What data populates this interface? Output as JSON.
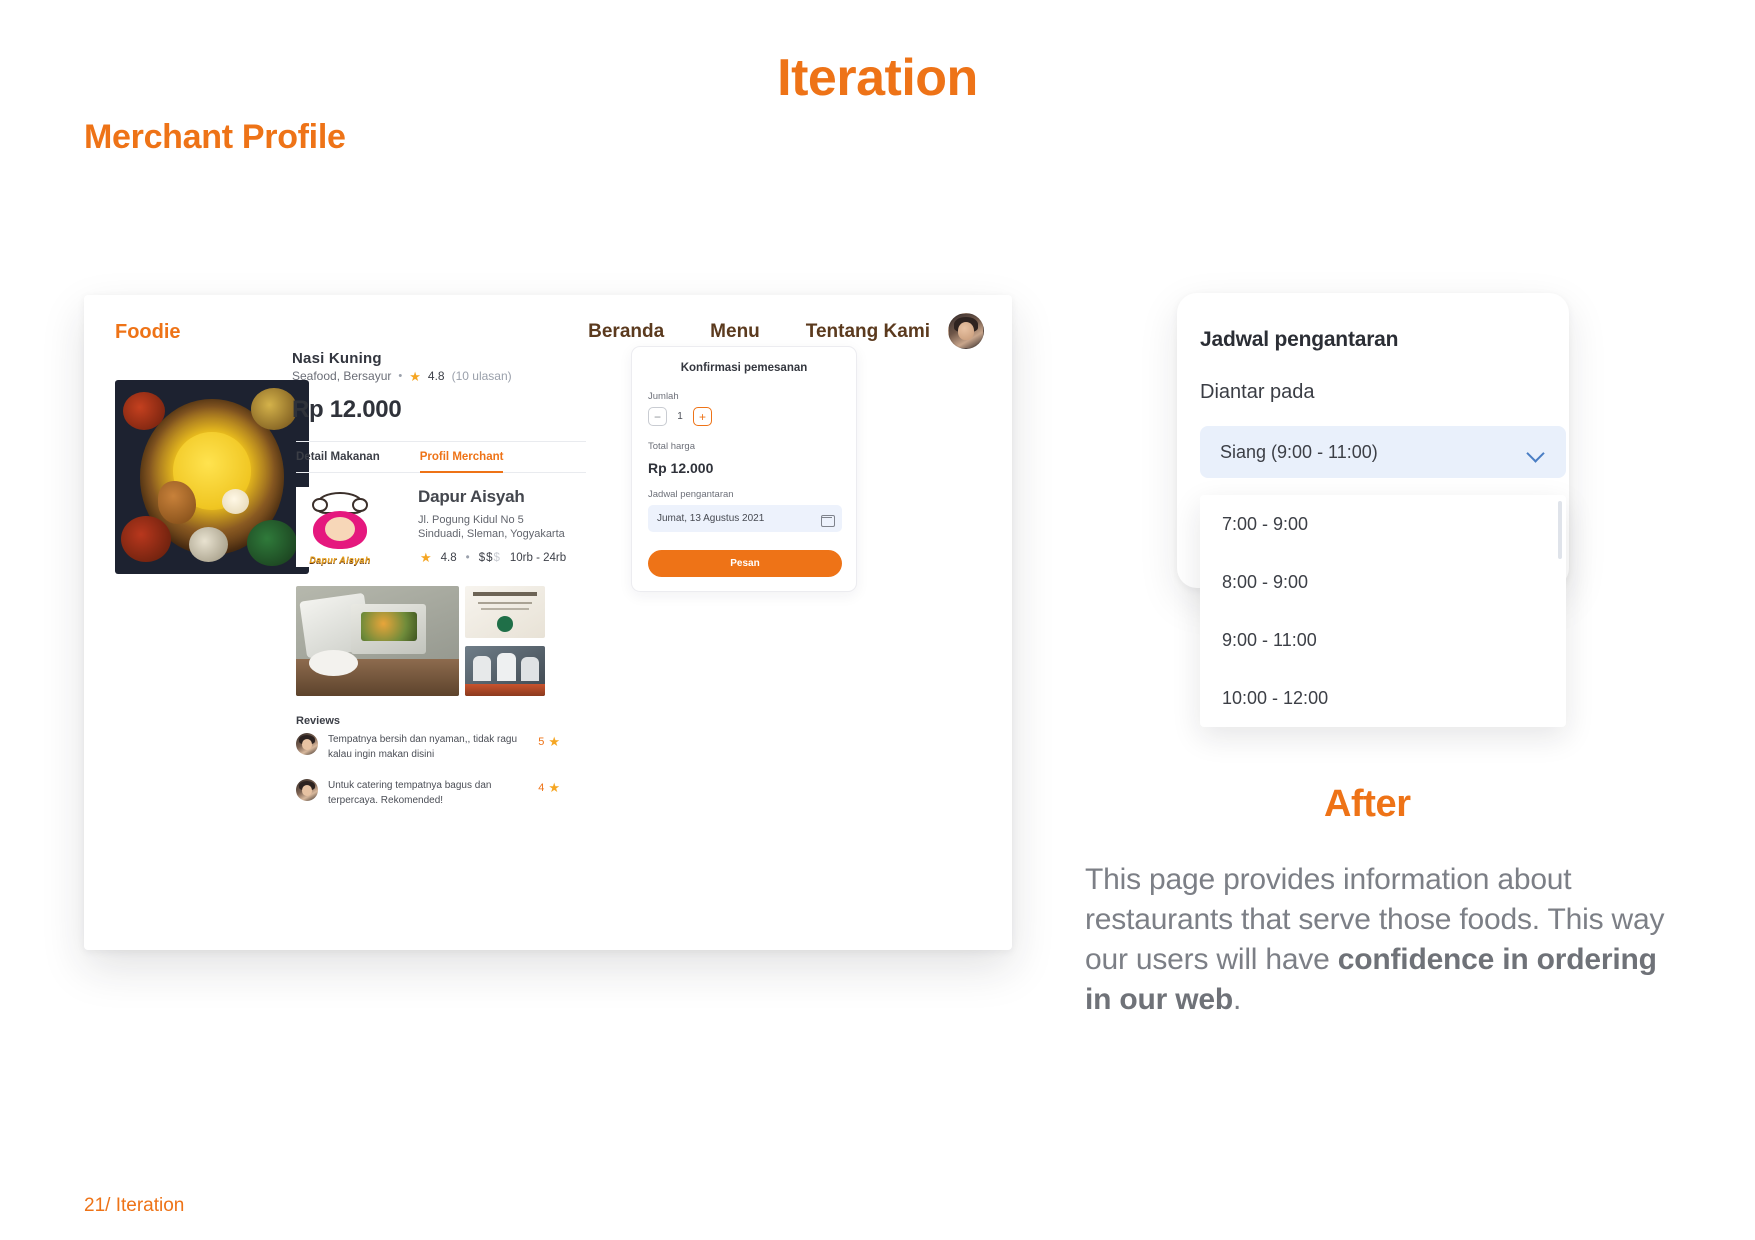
{
  "slide": {
    "title": "Iteration",
    "section_title": "Merchant Profile",
    "footer": "21/ Iteration"
  },
  "mockup": {
    "nav": {
      "brand": "Foodie",
      "links": [
        "Beranda",
        "Menu",
        "Tentang Kami"
      ],
      "avatar_name": "user-avatar"
    },
    "product": {
      "name": "Nasi Kuning",
      "categories": "Seafood, Bersayur",
      "separator": "•",
      "rating": "4.8",
      "reviews_count": "(10 ulasan)",
      "price": "Rp 12.000"
    },
    "tabs": [
      {
        "label": "Detail Makanan",
        "active": false
      },
      {
        "label": "Profil Merchant",
        "active": true
      }
    ],
    "merchant": {
      "logo_label": "Dapur Aisyah",
      "name": "Dapur Aisyah",
      "address_line1": "Jl. Pogung Kidul No 5",
      "address_line2": "Sinduadi, Sleman, Yogyakarta",
      "rating": "4.8",
      "separator": "•",
      "price_level_active": "$$",
      "price_level_inactive": "$",
      "price_range": "10rb - 24rb"
    },
    "gallery": [
      "catering-buffet-photo",
      "halal-certificate-photo",
      "chefs-kitchen-photo"
    ],
    "reviews": {
      "heading": "Reviews",
      "items": [
        {
          "text": "Tempatnya bersih dan nyaman,, tidak ragu kalau ingin makan disini",
          "score": "5"
        },
        {
          "text": "Untuk catering tempatnya bagus dan terpercaya. Rekomended!",
          "score": "4"
        }
      ]
    },
    "order": {
      "title": "Konfirmasi pemesanan",
      "quantity_label": "Jumlah",
      "quantity_value": "1",
      "minus_label": "−",
      "plus_label": "+",
      "total_label": "Total harga",
      "total_value": "Rp 12.000",
      "schedule_label": "Jadwal pengantaran",
      "schedule_value": "Jumat, 13 Agustus 2021",
      "submit_label": "Pesan"
    }
  },
  "schedule_panel": {
    "heading": "Jadwal pengantaran",
    "subheading": "Diantar pada",
    "selected_value": "Siang (9:00 - 11:00)",
    "options": [
      "7:00 - 9:00",
      "8:00 - 9:00",
      "9:00 - 11:00",
      "10:00 - 12:00"
    ]
  },
  "after": {
    "title": "After",
    "body_part1": "This page provides information about restaurants that serve those foods. This way our users will have ",
    "body_bold": "confidence in ordering in our web",
    "body_part2": "."
  },
  "colors": {
    "accent": "#EE7317",
    "nav_text": "#5B3A1E",
    "muted": "#7C7F86",
    "field_bg": "#E9F0FB"
  }
}
